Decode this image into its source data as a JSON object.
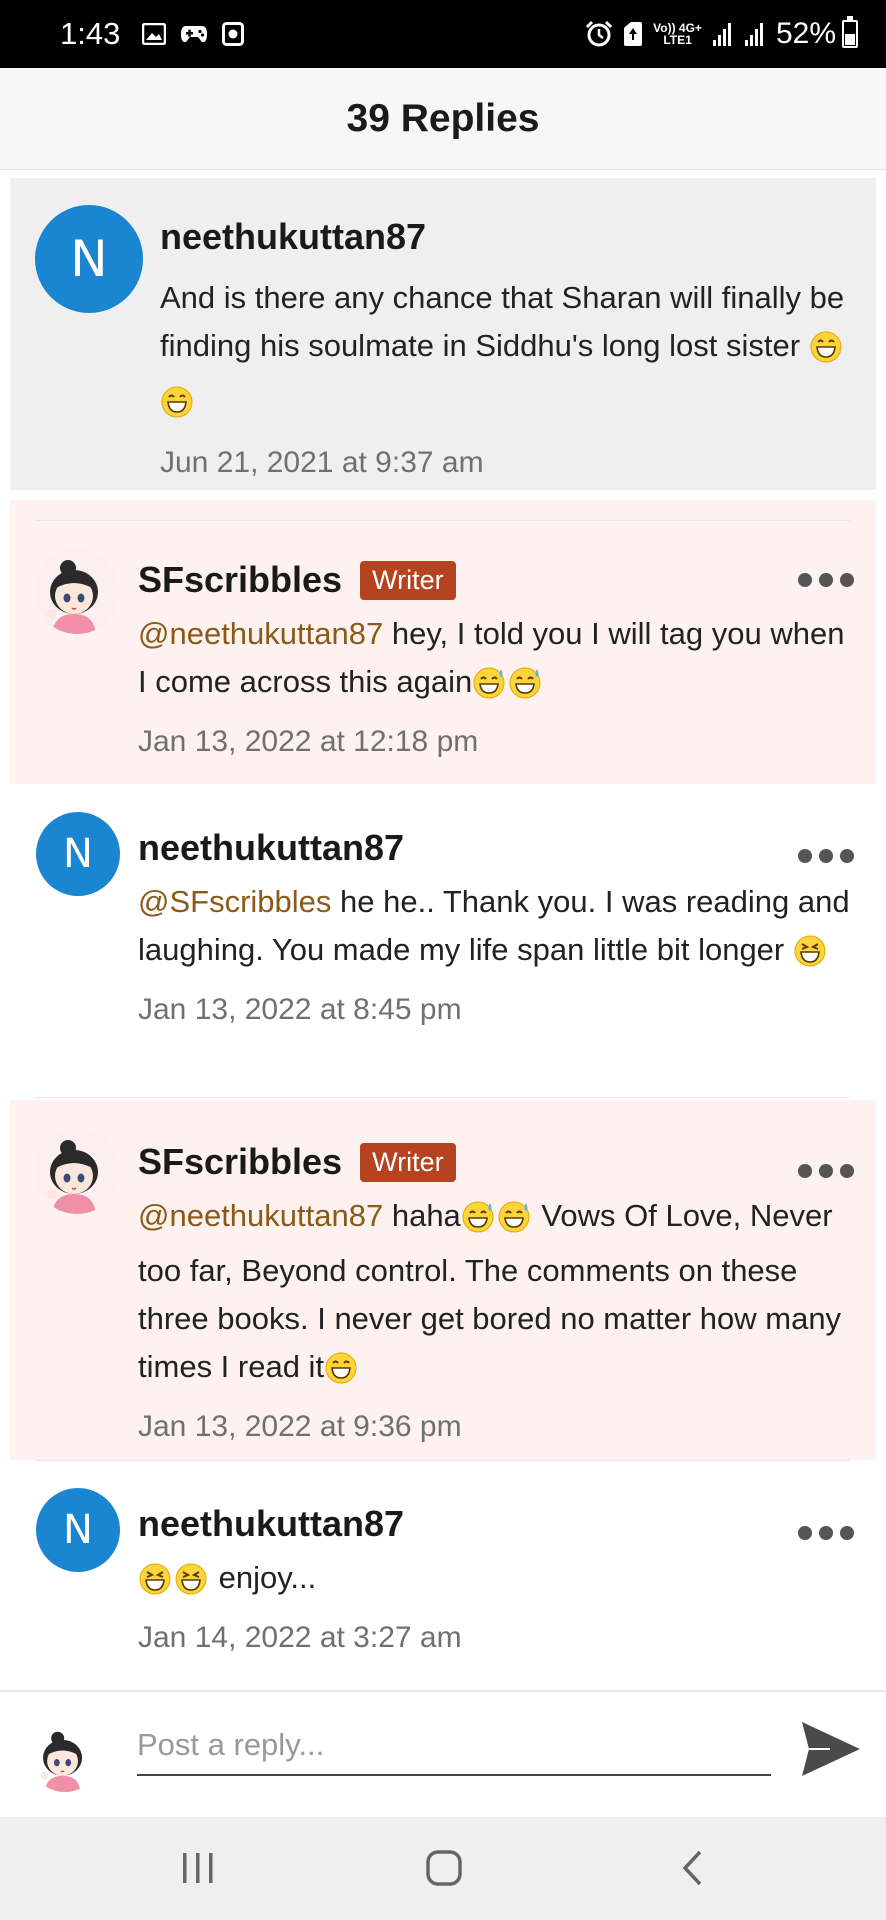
{
  "status_bar": {
    "time": "1:43",
    "network_top": "Vo)) 4G+",
    "network_bottom": "LTE1",
    "battery": "52%",
    "battery_level": 0.52
  },
  "header": {
    "title": "39 Replies"
  },
  "parent_comment": {
    "username": "neethukuttan87",
    "avatar_letter": "N",
    "text": "And is there any chance that Sharan will finally be finding his soulmate in Siddhu's long lost sister",
    "emoji_count": 2,
    "date": "Jun 21, 2021 at 9:37 am"
  },
  "replies": [
    {
      "username": "SFscribbles",
      "badge": "Writer",
      "mention": "@neethukuttan87",
      "text": "  hey, I told you I will tag you when I come across this again",
      "trail_emoji": "sweat-smile",
      "date": "Jan 13, 2022 at 12:18 pm"
    },
    {
      "username": "neethukuttan87",
      "avatar_letter": "N",
      "mention": "@SFscribbles",
      "text": " he he.. Thank you. I was reading and laughing. You made my life span little bit longer ",
      "date": "Jan 13, 2022 at 8:45 pm"
    },
    {
      "username": "SFscribbles",
      "badge": "Writer",
      "mention": "@neethukuttan87",
      "text_a": " haha",
      "text_b": " Vows Of Love, Never too far, Beyond control. The comments on these three books. I never get bored no matter how many times I read it",
      "date": "Jan 13, 2022 at 9:36 pm"
    },
    {
      "username": "neethukuttan87",
      "avatar_letter": "N",
      "text": " enjoy...",
      "date": "Jan 14, 2022 at 3:27 am"
    }
  ],
  "composer": {
    "placeholder": "Post a reply..."
  },
  "colors": {
    "avatar_blue": "#1a86d1",
    "writer_badge": "#b5431f",
    "writer_bg": "#fdf2ef",
    "mention": "#8a5a18"
  }
}
